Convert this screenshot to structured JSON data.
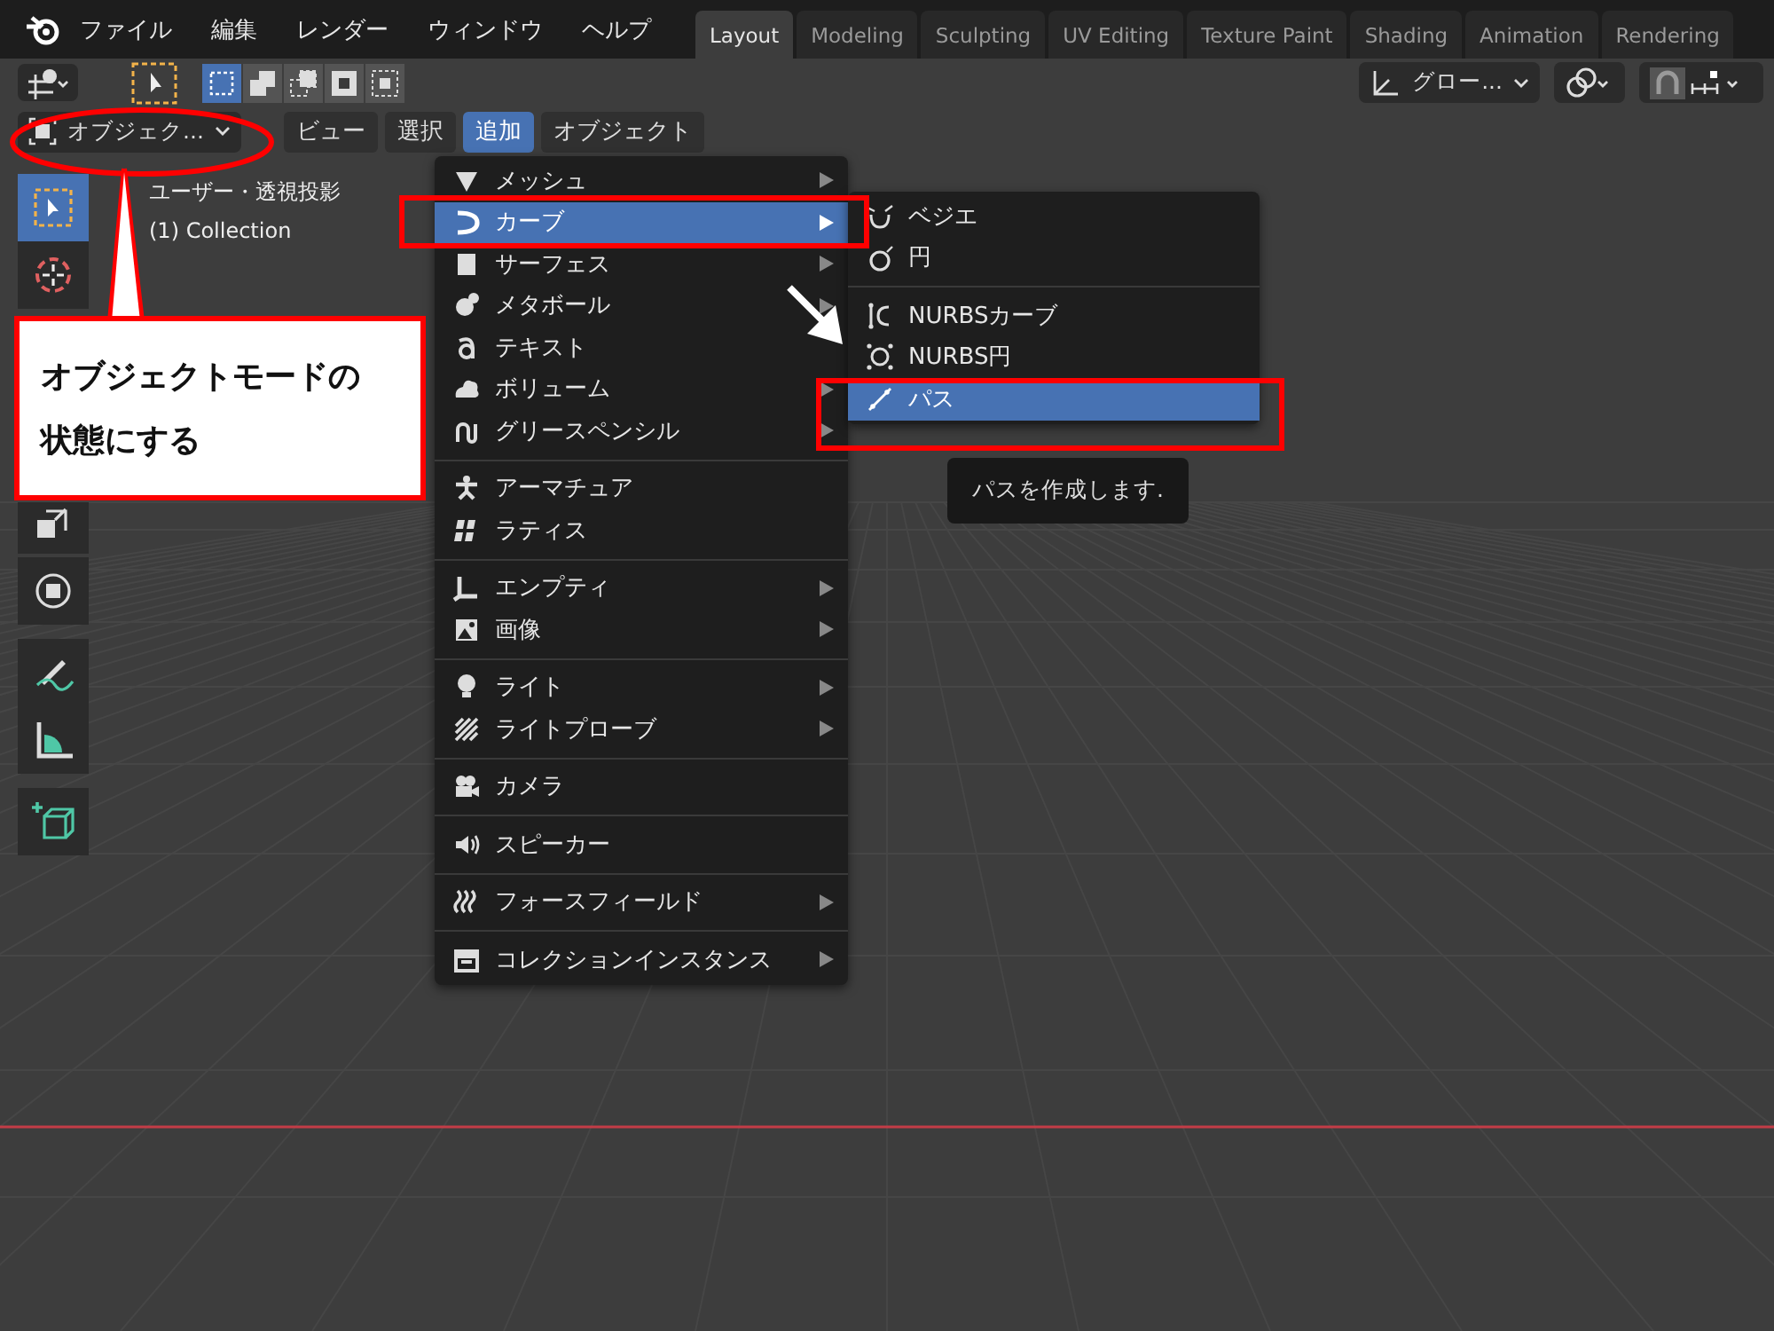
{
  "topbar": {
    "menus": [
      "ファイル",
      "編集",
      "レンダー",
      "ウィンドウ",
      "ヘルプ"
    ],
    "workspaces": [
      {
        "label": "Layout",
        "selected": true
      },
      {
        "label": "Modeling",
        "selected": false
      },
      {
        "label": "Sculpting",
        "selected": false
      },
      {
        "label": "UV Editing",
        "selected": false
      },
      {
        "label": "Texture Paint",
        "selected": false
      },
      {
        "label": "Shading",
        "selected": false
      },
      {
        "label": "Animation",
        "selected": false
      },
      {
        "label": "Rendering",
        "selected": false
      }
    ]
  },
  "tool_header": {
    "select_modes": [
      {
        "kind": "new",
        "selected": true
      },
      {
        "kind": "extend",
        "selected": false
      },
      {
        "kind": "subtract",
        "selected": false
      },
      {
        "kind": "invert",
        "selected": false
      },
      {
        "kind": "intersect",
        "selected": false
      }
    ],
    "orientation": "グロー..."
  },
  "view_header": {
    "mode": "オブジェク...",
    "menus": [
      {
        "label": "ビュー",
        "selected": false
      },
      {
        "label": "選択",
        "selected": false
      },
      {
        "label": "追加",
        "selected": true
      },
      {
        "label": "オブジェクト",
        "selected": false
      }
    ]
  },
  "viewport": {
    "view_name": "ユーザー・透視投影",
    "collection": "(1) Collection",
    "tools": [
      {
        "kind": "select",
        "selected": true
      },
      {
        "kind": "cursor",
        "selected": false
      },
      {
        "kind": "scale",
        "selected": false
      },
      {
        "kind": "transform",
        "selected": false
      },
      {
        "kind": "annotate",
        "selected": false
      },
      {
        "kind": "measure",
        "selected": false
      },
      {
        "kind": "add_cube",
        "selected": false
      }
    ]
  },
  "add_menu": {
    "groups": [
      [
        {
          "label": "メッシュ",
          "kind": "mesh",
          "submenu": true,
          "selected": false
        },
        {
          "label": "カーブ",
          "kind": "curve",
          "submenu": true,
          "selected": true
        },
        {
          "label": "サーフェス",
          "kind": "surface",
          "submenu": true,
          "selected": false
        },
        {
          "label": "メタボール",
          "kind": "metaball",
          "submenu": true,
          "selected": false
        },
        {
          "label": "テキスト",
          "kind": "text",
          "submenu": false,
          "selected": false
        },
        {
          "label": "ボリューム",
          "kind": "volume",
          "submenu": true,
          "selected": false
        },
        {
          "label": "グリースペンシル",
          "kind": "grease",
          "submenu": true,
          "selected": false
        }
      ],
      [
        {
          "label": "アーマチュア",
          "kind": "armature",
          "submenu": false,
          "selected": false
        },
        {
          "label": "ラティス",
          "kind": "lattice",
          "submenu": false,
          "selected": false
        }
      ],
      [
        {
          "label": "エンプティ",
          "kind": "empty",
          "submenu": true,
          "selected": false
        },
        {
          "label": "画像",
          "kind": "image",
          "submenu": true,
          "selected": false
        }
      ],
      [
        {
          "label": "ライト",
          "kind": "light",
          "submenu": true,
          "selected": false
        },
        {
          "label": "ライトプローブ",
          "kind": "probe",
          "submenu": true,
          "selected": false
        }
      ],
      [
        {
          "label": "カメラ",
          "kind": "camera",
          "submenu": false,
          "selected": false
        }
      ],
      [
        {
          "label": "スピーカー",
          "kind": "speaker",
          "submenu": false,
          "selected": false
        }
      ],
      [
        {
          "label": "フォースフィールド",
          "kind": "force",
          "submenu": true,
          "selected": false
        }
      ],
      [
        {
          "label": "コレクションインスタンス",
          "kind": "collection",
          "submenu": true,
          "selected": false
        }
      ]
    ]
  },
  "curve_submenu": {
    "groups": [
      [
        {
          "label": "ベジエ",
          "kind": "bezier",
          "selected": false
        },
        {
          "label": "円",
          "kind": "circle",
          "selected": false
        }
      ],
      [
        {
          "label": "NURBSカーブ",
          "kind": "nurbs",
          "selected": false
        },
        {
          "label": "NURBS円",
          "kind": "nurbs_circle",
          "selected": false
        },
        {
          "label": "パス",
          "kind": "path",
          "selected": true
        }
      ]
    ]
  },
  "tooltip": "パスを作成します.",
  "callout": "オブジェクトモードの状態にする"
}
